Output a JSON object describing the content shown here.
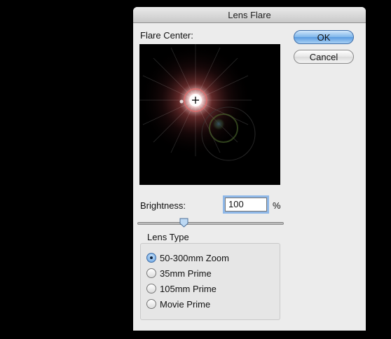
{
  "dialog": {
    "title": "Lens Flare",
    "flare_center_label": "Flare Center:",
    "ok_label": "OK",
    "cancel_label": "Cancel",
    "brightness_label": "Brightness:",
    "brightness_value": "100",
    "brightness_unit": "%",
    "brightness_slider_fraction": 0.32,
    "lens_type_label": "Lens Type",
    "lens_types": [
      {
        "label": "50-300mm Zoom",
        "selected": true
      },
      {
        "label": "35mm Prime",
        "selected": false
      },
      {
        "label": "105mm Prime",
        "selected": false
      },
      {
        "label": "Movie Prime",
        "selected": false
      }
    ]
  },
  "colors": {
    "accent": "#5a9be0",
    "dialog_bg": "#ececec",
    "screen_bg": "#000000"
  },
  "icons": {
    "flare_center_marker": "crosshair-icon"
  }
}
